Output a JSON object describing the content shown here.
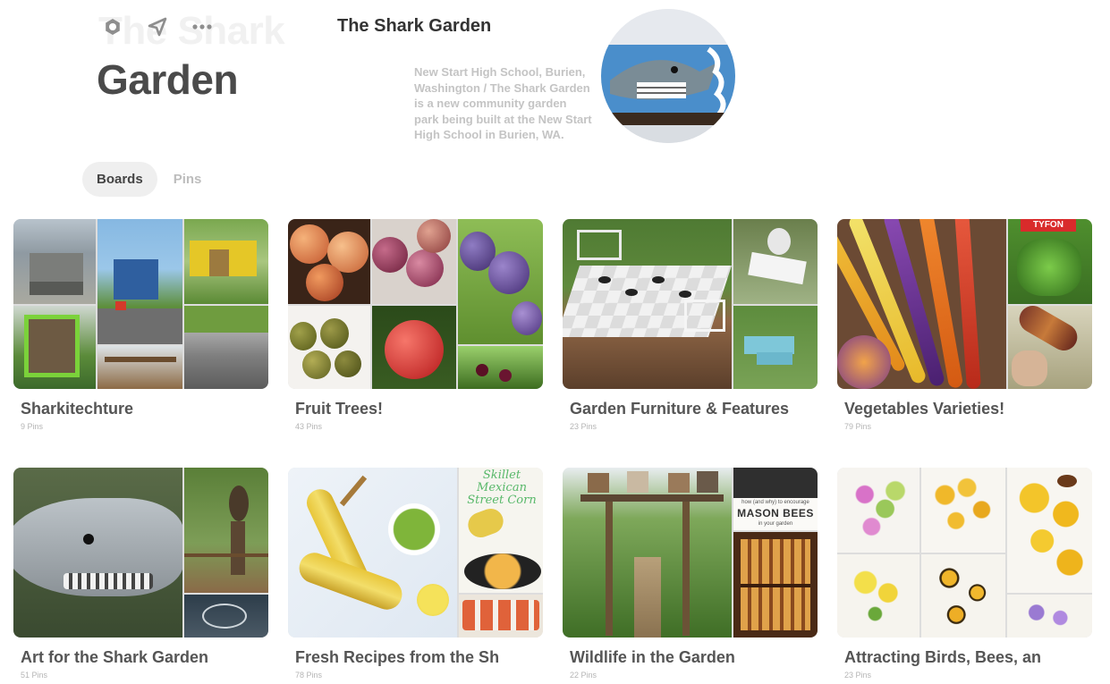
{
  "header": {
    "ghost_title": "The Shark",
    "title": "Garden",
    "small_title": "The Shark Garden",
    "about": "New Start High School, Burien, Washington / The Shark Garden is a new community garden park being built at the New Start High School in Burien, WA.",
    "icons": [
      "settings-icon",
      "share-icon",
      "more-icon"
    ]
  },
  "tabs": [
    {
      "label": "Boards",
      "active": true
    },
    {
      "label": "Pins",
      "active": false
    }
  ],
  "boards": [
    {
      "name": "Sharkitechture",
      "count": "9 Pins"
    },
    {
      "name": "Fruit Trees!",
      "count": "43 Pins"
    },
    {
      "name": "Garden Furniture & Features",
      "count": "23 Pins"
    },
    {
      "name": "Vegetables Varieties!",
      "count": "79 Pins"
    },
    {
      "name": "Art for the Shark Garden",
      "count": "51 Pins"
    },
    {
      "name": "Fresh Recipes from the Sh",
      "count": "78 Pins"
    },
    {
      "name": "Wildlife in the Garden",
      "count": "22 Pins"
    },
    {
      "name": "Attracting Birds, Bees, an",
      "count": "23 Pins"
    }
  ],
  "cover_texts": {
    "vegetables_tag": "TYFON",
    "recipes_caption": "Skillet Mexican Street Corn",
    "wildlife_caption_small": "how (and why) to encourage",
    "wildlife_caption_big": "MASON BEES",
    "wildlife_caption_tail": "in your garden"
  }
}
